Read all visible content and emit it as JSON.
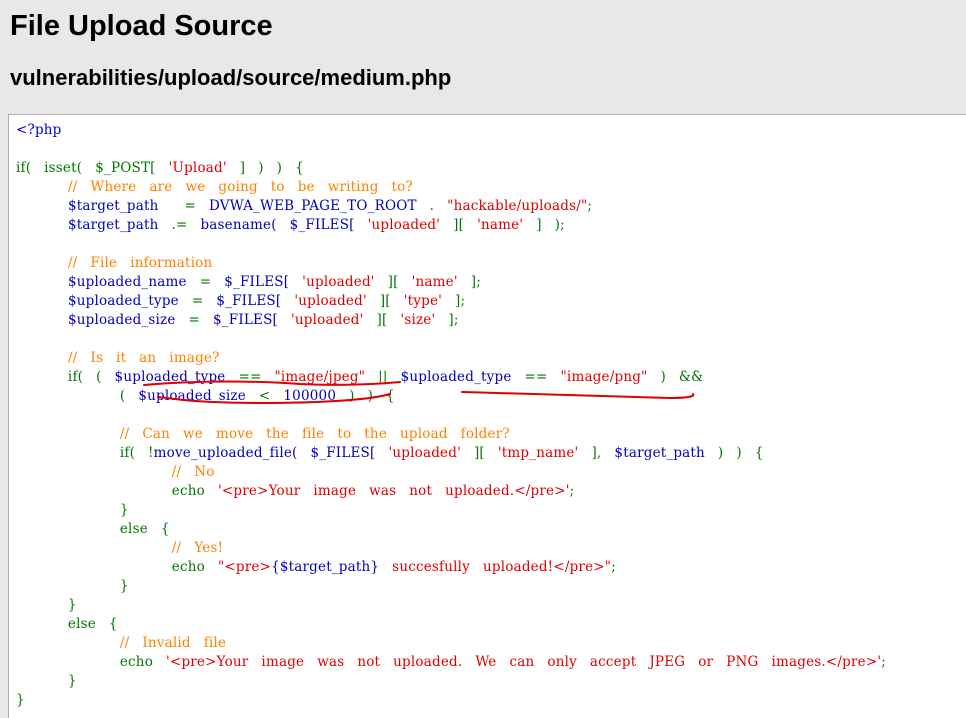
{
  "page": {
    "title": "File Upload Source",
    "source_path": "vulnerabilities/upload/source/medium.php"
  },
  "code": {
    "lines": [
      [
        {
          "t": "<?php",
          "c": "p"
        }
      ],
      [],
      [
        {
          "t": "if(  isset(  $_POST[  ",
          "c": "k"
        },
        {
          "t": "'Upload'",
          "c": "s"
        },
        {
          "t": "  ]  )  )  {",
          "c": "k"
        }
      ],
      [
        {
          "t": "        ",
          "c": "k"
        },
        {
          "t": "//  Where  are  we  going  to  be  writing  to?",
          "c": "c"
        }
      ],
      [
        {
          "t": "        ",
          "c": "k"
        },
        {
          "t": "$target_path",
          "c": "v"
        },
        {
          "t": "    =  ",
          "c": "k"
        },
        {
          "t": "DVWA_WEB_PAGE_TO_ROOT",
          "c": "v"
        },
        {
          "t": "  .  ",
          "c": "k"
        },
        {
          "t": "\"hackable/uploads/\"",
          "c": "s"
        },
        {
          "t": ";",
          "c": "k"
        }
      ],
      [
        {
          "t": "        ",
          "c": "k"
        },
        {
          "t": "$target_path",
          "c": "v"
        },
        {
          "t": "  .=  ",
          "c": "k"
        },
        {
          "t": "basename(  ",
          "c": "v"
        },
        {
          "t": "$_FILES[  ",
          "c": "v"
        },
        {
          "t": "'uploaded'",
          "c": "s"
        },
        {
          "t": "  ][  ",
          "c": "k"
        },
        {
          "t": "'name'",
          "c": "s"
        },
        {
          "t": "  ]  );",
          "c": "k"
        }
      ],
      [],
      [
        {
          "t": "        ",
          "c": "k"
        },
        {
          "t": "//  File  information",
          "c": "c"
        }
      ],
      [
        {
          "t": "        ",
          "c": "k"
        },
        {
          "t": "$uploaded_name",
          "c": "v"
        },
        {
          "t": "  =  ",
          "c": "k"
        },
        {
          "t": "$_FILES[  ",
          "c": "v"
        },
        {
          "t": "'uploaded'",
          "c": "s"
        },
        {
          "t": "  ][  ",
          "c": "k"
        },
        {
          "t": "'name'",
          "c": "s"
        },
        {
          "t": "  ];",
          "c": "k"
        }
      ],
      [
        {
          "t": "        ",
          "c": "k"
        },
        {
          "t": "$uploaded_type",
          "c": "v"
        },
        {
          "t": "  =  ",
          "c": "k"
        },
        {
          "t": "$_FILES[  ",
          "c": "v"
        },
        {
          "t": "'uploaded'",
          "c": "s"
        },
        {
          "t": "  ][  ",
          "c": "k"
        },
        {
          "t": "'type'",
          "c": "s"
        },
        {
          "t": "  ];",
          "c": "k"
        }
      ],
      [
        {
          "t": "        ",
          "c": "k"
        },
        {
          "t": "$uploaded_size",
          "c": "v"
        },
        {
          "t": "  =  ",
          "c": "k"
        },
        {
          "t": "$_FILES[  ",
          "c": "v"
        },
        {
          "t": "'uploaded'",
          "c": "s"
        },
        {
          "t": "  ][  ",
          "c": "k"
        },
        {
          "t": "'size'",
          "c": "s"
        },
        {
          "t": "  ];",
          "c": "k"
        }
      ],
      [],
      [
        {
          "t": "        ",
          "c": "k"
        },
        {
          "t": "//  Is  it  an  image?",
          "c": "c"
        }
      ],
      [
        {
          "t": "        if(  (  ",
          "c": "k"
        },
        {
          "t": "$uploaded_type",
          "c": "v"
        },
        {
          "t": "  ==  ",
          "c": "k"
        },
        {
          "t": "\"image/jpeg\"",
          "c": "s"
        },
        {
          "t": "  ||  ",
          "c": "k"
        },
        {
          "t": "$uploaded_type",
          "c": "v"
        },
        {
          "t": "  ==  ",
          "c": "k"
        },
        {
          "t": "\"image/png\"",
          "c": "s"
        },
        {
          "t": "  )  &&",
          "c": "k"
        }
      ],
      [
        {
          "t": "                (  ",
          "c": "k"
        },
        {
          "t": "$uploaded_size",
          "c": "v"
        },
        {
          "t": "  <  ",
          "c": "k"
        },
        {
          "t": "100000",
          "c": "v"
        },
        {
          "t": "  )  )  {",
          "c": "k"
        }
      ],
      [],
      [
        {
          "t": "                ",
          "c": "k"
        },
        {
          "t": "//  Can  we  move  the  file  to  the  upload  folder?",
          "c": "c"
        }
      ],
      [
        {
          "t": "                if(  !",
          "c": "k"
        },
        {
          "t": "move_uploaded_file(  ",
          "c": "v"
        },
        {
          "t": "$_FILES[  ",
          "c": "v"
        },
        {
          "t": "'uploaded'",
          "c": "s"
        },
        {
          "t": "  ][  ",
          "c": "k"
        },
        {
          "t": "'tmp_name'",
          "c": "s"
        },
        {
          "t": "  ],  ",
          "c": "k"
        },
        {
          "t": "$target_path",
          "c": "v"
        },
        {
          "t": "  )  )  {",
          "c": "k"
        }
      ],
      [
        {
          "t": "                        ",
          "c": "k"
        },
        {
          "t": "//  No",
          "c": "c"
        }
      ],
      [
        {
          "t": "                        echo  ",
          "c": "k"
        },
        {
          "t": "'<pre>Your  image  was  not  uploaded.</pre>'",
          "c": "s"
        },
        {
          "t": ";",
          "c": "k"
        }
      ],
      [
        {
          "t": "                }",
          "c": "k"
        }
      ],
      [
        {
          "t": "                else  {",
          "c": "k"
        }
      ],
      [
        {
          "t": "                        ",
          "c": "k"
        },
        {
          "t": "//  Yes!",
          "c": "c"
        }
      ],
      [
        {
          "t": "                        echo  ",
          "c": "k"
        },
        {
          "t": "\"<pre>",
          "c": "s"
        },
        {
          "t": "{$target_path}",
          "c": "v"
        },
        {
          "t": "  succesfully  uploaded!</pre>\"",
          "c": "s"
        },
        {
          "t": ";",
          "c": "k"
        }
      ],
      [
        {
          "t": "                }",
          "c": "k"
        }
      ],
      [
        {
          "t": "        }",
          "c": "k"
        }
      ],
      [
        {
          "t": "        else  {",
          "c": "k"
        }
      ],
      [
        {
          "t": "                ",
          "c": "k"
        },
        {
          "t": "//  Invalid  file",
          "c": "c"
        }
      ],
      [
        {
          "t": "                echo  ",
          "c": "k"
        },
        {
          "t": "'<pre>Your  image  was  not  uploaded.  We  can  only  accept  JPEG  or  PNG  images.</pre>'",
          "c": "s"
        },
        {
          "t": ";",
          "c": "k"
        }
      ],
      [
        {
          "t": "        }",
          "c": "k"
        }
      ],
      [
        {
          "t": "}",
          "c": "k"
        }
      ]
    ]
  },
  "colors": {
    "keyword": "#007700",
    "variable": "#0000bb",
    "string": "#dd0000",
    "comment": "#ff8000",
    "annotation": "#e00000"
  }
}
